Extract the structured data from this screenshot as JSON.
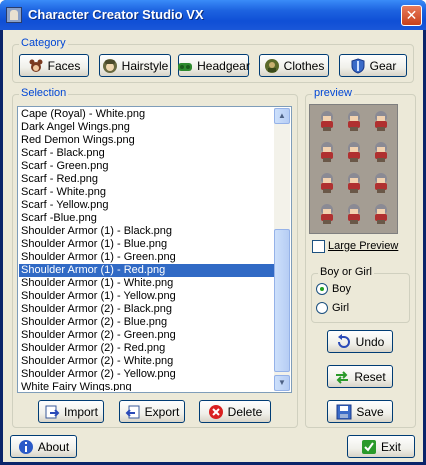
{
  "window": {
    "title": "Character Creator Studio VX",
    "close_label": "✕"
  },
  "category": {
    "label": "Category",
    "buttons": [
      {
        "label": "Faces",
        "icon": "faces-icon"
      },
      {
        "label": "Hairstyle",
        "icon": "hairstyle-icon"
      },
      {
        "label": "Headgear",
        "icon": "headgear-icon"
      },
      {
        "label": "Clothes",
        "icon": "clothes-icon"
      },
      {
        "label": "Gear",
        "icon": "gear-shield-icon"
      }
    ]
  },
  "selection": {
    "label": "Selection",
    "items": [
      "Cape (Royal) - White.png",
      "Dark Angel Wings.png",
      "Red Demon Wings.png",
      "Scarf - Black.png",
      "Scarf - Green.png",
      "Scarf - Red.png",
      "Scarf - White.png",
      "Scarf - Yellow.png",
      "Scarf -Blue.png",
      "Shoulder Armor (1) - Black.png",
      "Shoulder Armor (1) - Blue.png",
      "Shoulder Armor (1) - Green.png",
      "Shoulder Armor (1) - Red.png",
      "Shoulder Armor (1) - White.png",
      "Shoulder Armor (1) - Yellow.png",
      "Shoulder Armor (2) - Black.png",
      "Shoulder Armor (2) - Blue.png",
      "Shoulder Armor (2) - Green.png",
      "Shoulder Armor (2) - Red.png",
      "Shoulder Armor (2) - White.png",
      "Shoulder Armor (2) - Yellow.png",
      "White Fairy Wings.png"
    ],
    "selected_index": 12,
    "import_label": "Import",
    "export_label": "Export",
    "delete_label": "Delete"
  },
  "preview": {
    "label": "preview",
    "large_preview_label": "Large Preview",
    "large_preview_checked": false,
    "gender_label": "Boy or Girl",
    "boy_label": "Boy",
    "girl_label": "Girl",
    "selected_gender": "Boy"
  },
  "actions": {
    "undo_label": "Undo",
    "reset_label": "Reset",
    "save_label": "Save"
  },
  "footer": {
    "about_label": "About",
    "exit_label": "Exit"
  },
  "colors": {
    "selection": "#316ac5",
    "group_label": "#0046d5",
    "title_bar": "#0f4fd6",
    "delete_red": "#d92020"
  }
}
